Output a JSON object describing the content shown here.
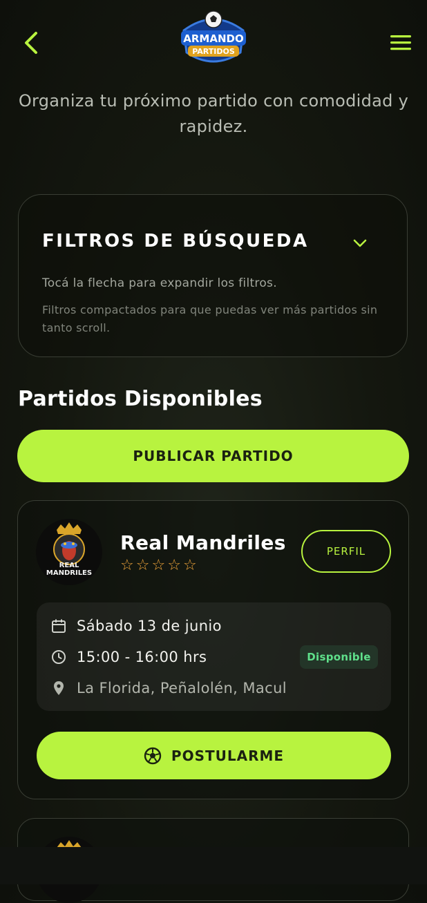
{
  "header": {
    "back_icon": "chevron-left-icon",
    "menu_icon": "hamburger-menu-icon",
    "logo_text_top": "ARMANDO",
    "logo_text_bottom": "PARTIDOS"
  },
  "tagline": "Organiza tu próximo partido con comodidad y rapidez.",
  "filters": {
    "title": "FILTROS DE BÚSQUEDA",
    "toggle_icon": "chevron-down-icon",
    "hint": "Tocá la flecha para expandir los filtros.",
    "note": "Filtros compactados para que puedas ver más partidos sin tanto scroll."
  },
  "section_title": "Partidos Disponibles",
  "publish_label": "PUBLICAR PARTIDO",
  "matches": [
    {
      "team": "Real Mandriles",
      "avatar_text_top": "REAL",
      "avatar_text_bottom": "MANDRILES",
      "rating": 0,
      "rating_max": 5,
      "profile_label": "PERFIL",
      "date": "Sábado 13 de junio",
      "time": "15:00 - 16:00 hrs",
      "location": "La Florida, Peñalolén, Macul",
      "status": "Disponible",
      "apply_label": "POSTULARME"
    }
  ],
  "colors": {
    "accent": "#b8f33f",
    "star": "#f0a53a",
    "status_text": "#5fe08b",
    "status_bg": "#233528"
  }
}
